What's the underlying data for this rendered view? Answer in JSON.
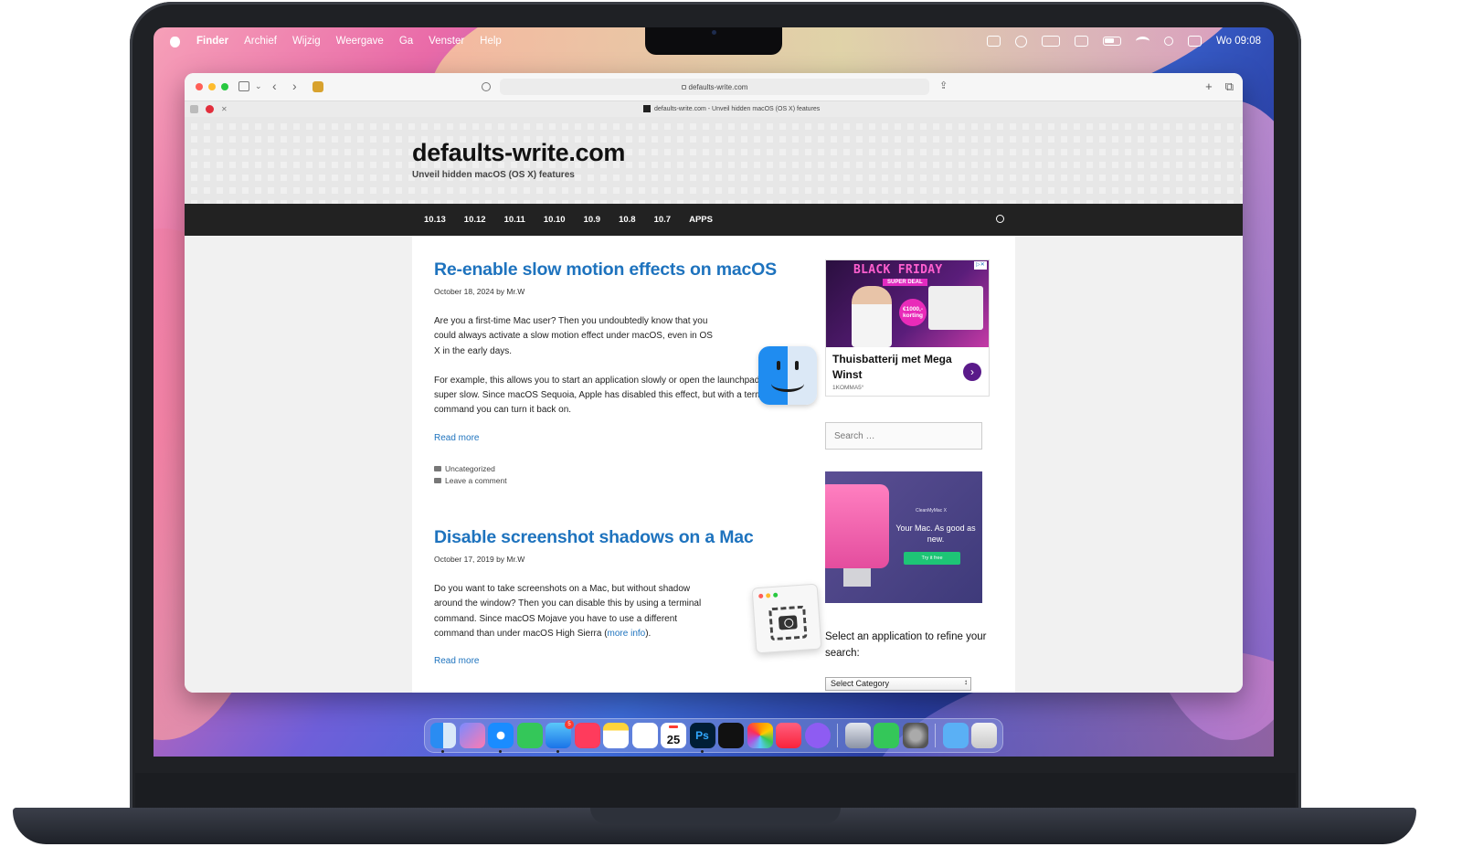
{
  "menubar": {
    "app_name": "Finder",
    "items": [
      "Archief",
      "Wijzig",
      "Weergave",
      "Ga",
      "Venster",
      "Help"
    ],
    "clock": "Wo 09:08"
  },
  "browser": {
    "address": "defaults-write.com",
    "tab_title": "defaults-write.com - Unveil hidden macOS (OS X) features"
  },
  "site": {
    "title": "defaults-write.com",
    "description": "Unveil hidden macOS (OS X) features",
    "nav": [
      "10.13",
      "10.12",
      "10.11",
      "10.10",
      "10.9",
      "10.8",
      "10.7",
      "APPS"
    ]
  },
  "posts": [
    {
      "title": "Re-enable slow motion effects on macOS",
      "date": "October 18, 2024",
      "author_prefix": "by",
      "author": "Mr.W",
      "paragraph1": "Are you a first-time Mac user? Then you undoubtedly know that you could always activate a slow motion effect under macOS, even in OS X in the early days.",
      "paragraph2": "For example, this allows you to start an application slowly or open the launchpad super slow. Since macOS Sequoia, Apple has disabled this effect, but with a terminal command you can turn it back on.",
      "read_more": "Read more",
      "category": "Uncategorized",
      "comment": "Leave a comment"
    },
    {
      "title": "Disable screenshot shadows on a Mac",
      "date": "October 17, 2019",
      "author_prefix": "by",
      "author": "Mr.W",
      "paragraph1": "Do you want to take screenshots on a Mac, but without shadow around the window? Then you can disable this by using a terminal command. Since macOS Mojave you have to use a different command than under macOS High Sierra (",
      "more_info": "more info",
      "paragraph1_end": ").",
      "read_more": "Read more"
    }
  ],
  "sidebar": {
    "ad1": {
      "banner": "BLACK FRIDAY",
      "badge": "SUPER DEAL",
      "price": "€1000,- korting",
      "headline": "Thuisbatterij met Mega Winst",
      "brand": "1KOMMA5°",
      "arrow": "›"
    },
    "search_placeholder": "Search …",
    "ad2": {
      "brand": "CleanMyMac X",
      "headline": "Your Mac. As good as new.",
      "button": "Try it free"
    },
    "refine_text": "Select an application to refine your search:",
    "select_value": "Select Category"
  },
  "dock": {
    "mail_badge": "5",
    "calendar_day": "25",
    "photoshop_label": "Ps"
  },
  "colors": {
    "link": "#1e73be",
    "nav_bg": "#222222",
    "ad_purple": "#5a1a8a"
  }
}
